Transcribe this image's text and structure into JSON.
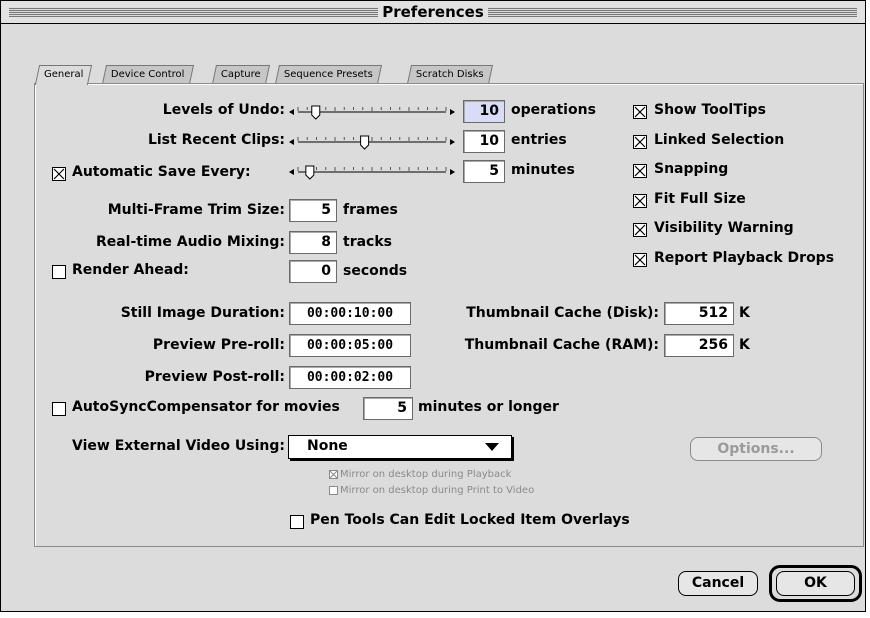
{
  "window": {
    "title": "Preferences"
  },
  "tabs": [
    "General",
    "Device Control",
    "Capture",
    "Sequence Presets",
    "Scratch Disks"
  ],
  "sliders": {
    "levels_of_undo": {
      "label": "Levels of Undo:",
      "value": "10",
      "unit": "operations",
      "position": 0.12
    },
    "list_recent_clips": {
      "label": "List Recent Clips:",
      "value": "10",
      "unit": "entries",
      "position": 0.45
    },
    "autosave": {
      "label": "Automatic Save Every:",
      "value": "5",
      "unit": "minutes",
      "checked": true,
      "position": 0.08
    }
  },
  "right_checks": [
    {
      "label": "Show ToolTips",
      "checked": true
    },
    {
      "label": "Linked Selection",
      "checked": true
    },
    {
      "label": "Snapping",
      "checked": true
    },
    {
      "label": "Fit Full Size",
      "checked": true
    },
    {
      "label": "Visibility Warning",
      "checked": true
    },
    {
      "label": "Report Playback Drops",
      "checked": true
    }
  ],
  "fields": {
    "trim": {
      "label": "Multi-Frame Trim Size:",
      "value": "5",
      "unit": "frames"
    },
    "audio": {
      "label": "Real-time Audio Mixing:",
      "value": "8",
      "unit": "tracks"
    },
    "render": {
      "label": "Render Ahead:",
      "value": "0",
      "unit": "seconds",
      "checked": false
    }
  },
  "timecodes": {
    "still": {
      "label": "Still Image Duration:",
      "value": "00:00:10:00"
    },
    "preroll": {
      "label": "Preview Pre-roll:",
      "value": "00:00:05:00"
    },
    "postroll": {
      "label": "Preview Post-roll:",
      "value": "00:00:02:00"
    }
  },
  "cache": {
    "disk": {
      "label": "Thumbnail Cache (Disk):",
      "value": "512",
      "unit": "K"
    },
    "ram": {
      "label": "Thumbnail Cache (RAM):",
      "value": "256",
      "unit": "K"
    }
  },
  "autosync": {
    "label": "AutoSyncCompensator for movies",
    "value": "5",
    "unit": "minutes or longer",
    "checked": false
  },
  "external_video": {
    "label": "View External Video Using:",
    "selected": "None",
    "options_button": "Options...",
    "mirror_playback": "Mirror on desktop during Playback",
    "mirror_print": "Mirror on desktop during Print to Video"
  },
  "pen_tools": {
    "label": "Pen Tools Can Edit Locked Item Overlays",
    "checked": false
  },
  "buttons": {
    "cancel": "Cancel",
    "ok": "OK"
  }
}
